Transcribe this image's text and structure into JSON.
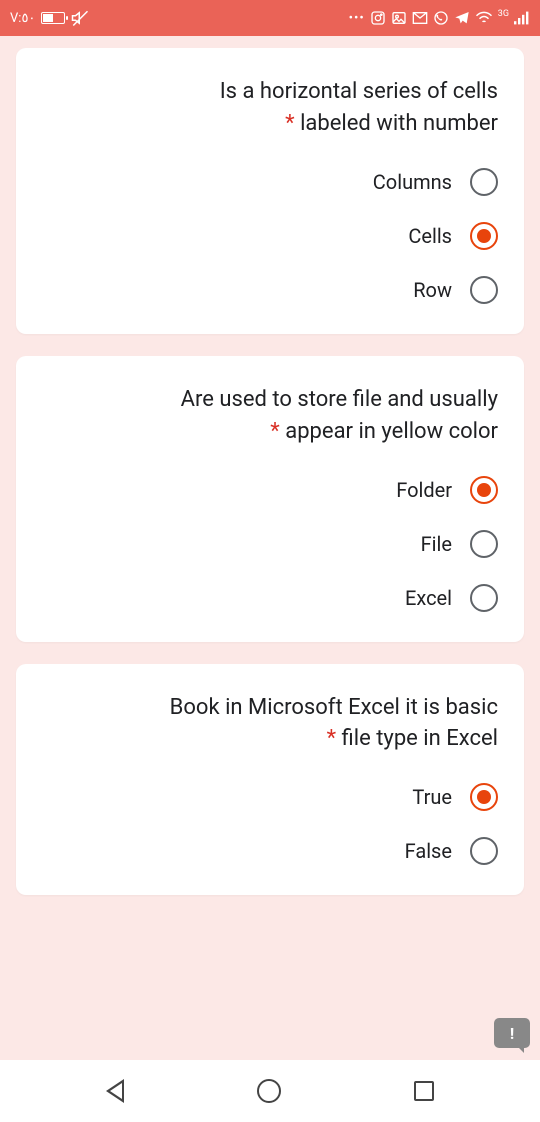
{
  "status": {
    "left_text": "V:٥٠",
    "network_badge": "3G"
  },
  "questions": [
    {
      "text": "Is a horizontal series of cells labeled with number",
      "required": true,
      "options": [
        {
          "label": "Columns",
          "selected": false
        },
        {
          "label": "Cells",
          "selected": true
        },
        {
          "label": "Row",
          "selected": false
        }
      ]
    },
    {
      "text": "Are used to store file and usually appear in yellow color",
      "required": true,
      "options": [
        {
          "label": "Folder",
          "selected": true
        },
        {
          "label": "File",
          "selected": false
        },
        {
          "label": "Excel",
          "selected": false
        }
      ]
    },
    {
      "text": "Book in Microsoft Excel it is basic file type in Excel",
      "required": true,
      "options": [
        {
          "label": "True",
          "selected": true
        },
        {
          "label": "False",
          "selected": false
        }
      ]
    }
  ],
  "fab_text": "!"
}
